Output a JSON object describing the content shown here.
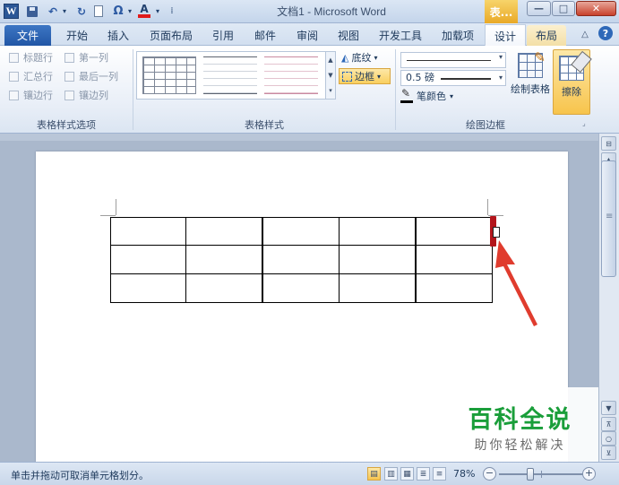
{
  "window": {
    "title": "文档1 - Microsoft Word",
    "context_tab_label": "表...",
    "app_icon_letter": "W",
    "minimize_glyph": "—",
    "maximize_glyph": "□",
    "close_glyph": "✕"
  },
  "quick_access": {
    "undo_glyph": "↶",
    "redo_glyph": "↻",
    "symbol_glyph": "Ω",
    "font_color_glyph": "A",
    "dropdown_glyph": "▾",
    "customize_glyph": "⁞"
  },
  "tabs": [
    {
      "label": "文件"
    },
    {
      "label": "开始"
    },
    {
      "label": "插入"
    },
    {
      "label": "页面布局"
    },
    {
      "label": "引用"
    },
    {
      "label": "邮件"
    },
    {
      "label": "审阅"
    },
    {
      "label": "视图"
    },
    {
      "label": "开发工具"
    },
    {
      "label": "加载项"
    },
    {
      "label": "设计"
    },
    {
      "label": "布局"
    }
  ],
  "active_tab": "设计",
  "help_glyph": "?",
  "collapse_glyph": "△",
  "ribbon": {
    "style_options": {
      "label": "表格样式选项",
      "checkboxes": [
        {
          "label": "标题行",
          "checked": false
        },
        {
          "label": "第一列",
          "checked": false
        },
        {
          "label": "汇总行",
          "checked": false
        },
        {
          "label": "最后一列",
          "checked": false
        },
        {
          "label": "镶边行",
          "checked": false
        },
        {
          "label": "镶边列",
          "checked": false
        }
      ]
    },
    "table_styles": {
      "label": "表格样式",
      "scroll_glyphs": [
        "▲",
        "▼",
        "▾"
      ],
      "shading_label": "底纹",
      "borders_label": "边框"
    },
    "draw_borders": {
      "label": "绘图边框",
      "line_width": "0.5 磅",
      "pen_color_label": "笔颜色",
      "draw_table_label": "绘制表格",
      "eraser_label": "擦除",
      "launcher_glyph": "⌟"
    }
  },
  "document": {
    "table": {
      "rows": 3,
      "cols": 5
    }
  },
  "scrollbar": {
    "up_glyph": "▲",
    "down_glyph": "▼",
    "prev_glyph": "⊼",
    "browse_glyph": "○",
    "next_glyph": "⊻",
    "ruler_glyph": "⊟"
  },
  "watermark": {
    "title": "百科全说",
    "subtitle": "助你轻松解决"
  },
  "status": {
    "message": "单击并拖动可取消单元格划分。",
    "zoom": "78%",
    "zoom_out_glyph": "−",
    "zoom_in_glyph": "+",
    "view_glyphs": [
      "▤",
      "▥",
      "▦",
      "≣",
      "≡"
    ]
  },
  "colors": {
    "accent_blue": "#2b5797",
    "active_highlight": "#f9cf5f",
    "arrow_red": "#e03c2e",
    "watermark_green": "#1a9e3a"
  }
}
